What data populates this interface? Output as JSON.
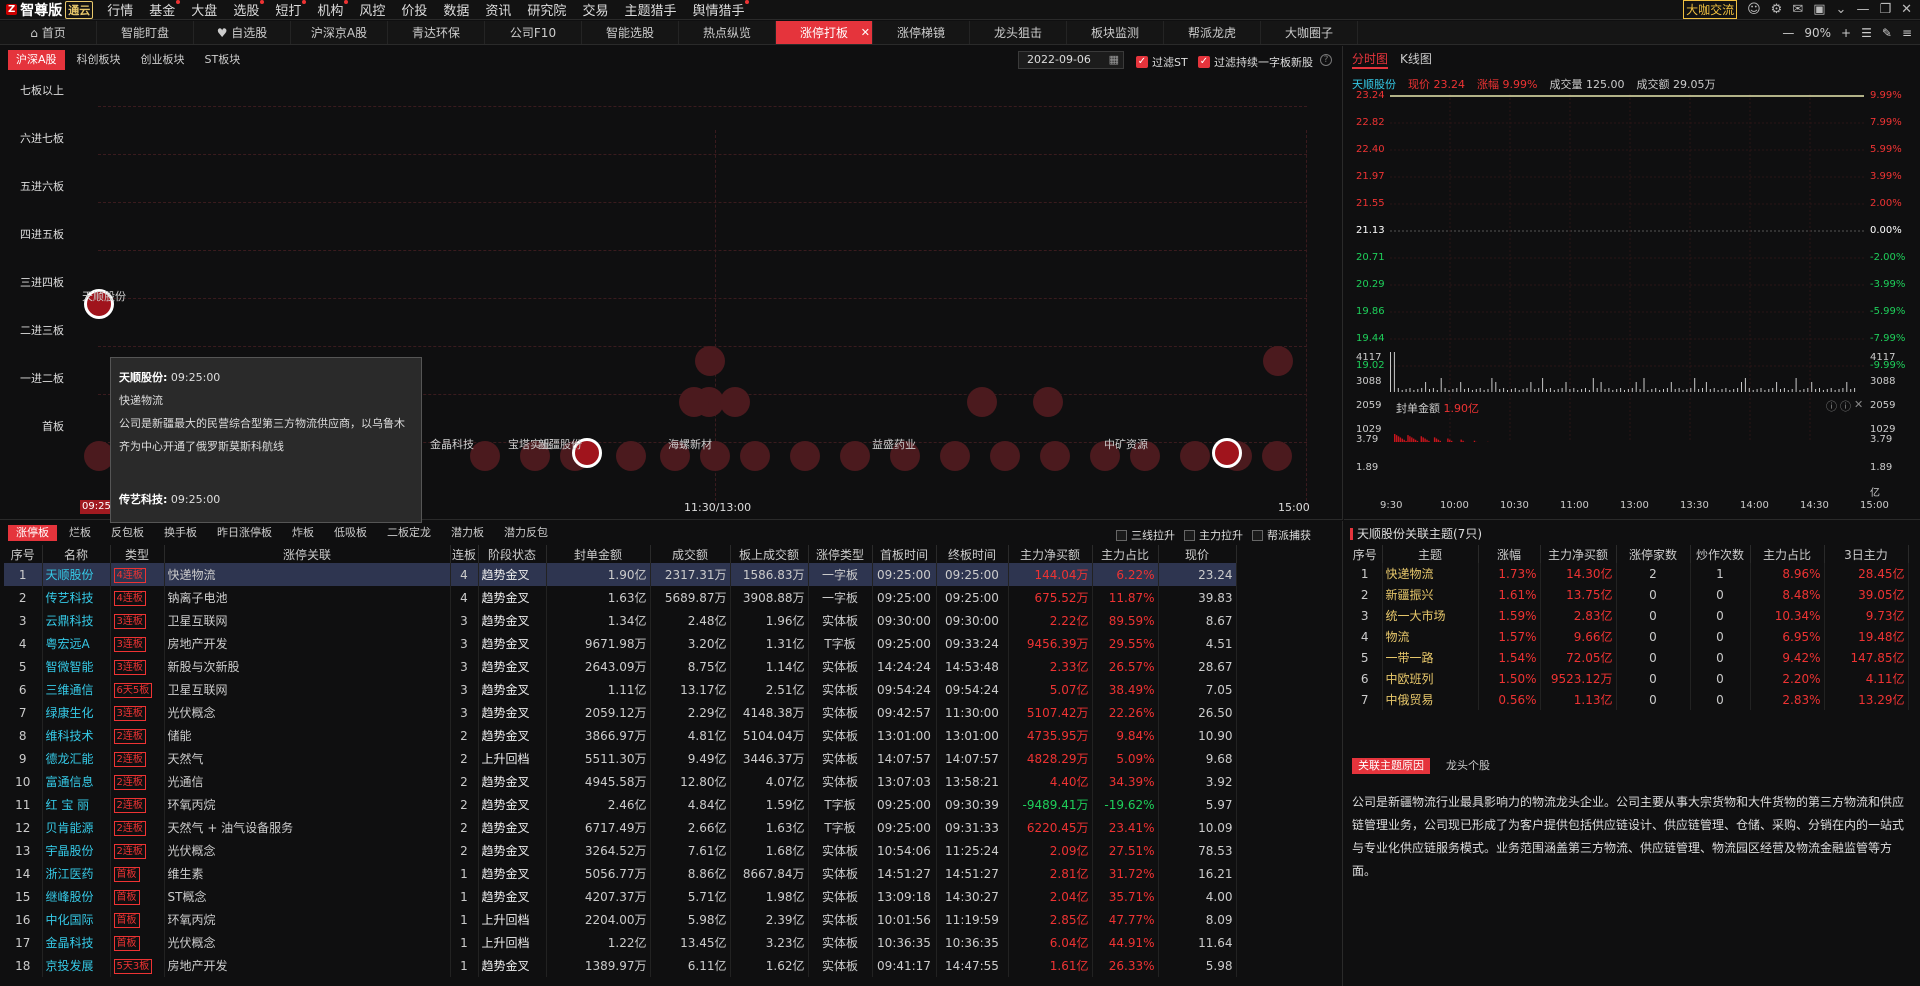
{
  "app": {
    "name": "智尊版",
    "version": "通云"
  },
  "menu": [
    {
      "label": "行情",
      "dot": false
    },
    {
      "label": "基金",
      "dot": true
    },
    {
      "label": "大盘",
      "dot": false
    },
    {
      "label": "选股",
      "dot": true
    },
    {
      "label": "短打",
      "dot": true
    },
    {
      "label": "机构",
      "dot": true
    },
    {
      "label": "风控",
      "dot": false
    },
    {
      "label": "价投",
      "dot": false
    },
    {
      "label": "数据",
      "dot": false
    },
    {
      "label": "资讯",
      "dot": false
    },
    {
      "label": "研究院",
      "dot": false
    },
    {
      "label": "交易",
      "dot": false
    },
    {
      "label": "主题猎手",
      "dot": false
    },
    {
      "label": "舆情猎手",
      "dot": true
    }
  ],
  "top_right": {
    "link": "大咖交流"
  },
  "tabs": [
    {
      "label": "首页",
      "icon": "home-icon"
    },
    {
      "label": "智能盯盘"
    },
    {
      "label": "自选股",
      "icon": "heart-icon"
    },
    {
      "label": "沪深京A股"
    },
    {
      "label": "青达环保"
    },
    {
      "label": "公司F10"
    },
    {
      "label": "智能选股"
    },
    {
      "label": "热点纵览"
    },
    {
      "label": "涨停打板",
      "active": true
    },
    {
      "label": "涨停梯镜"
    },
    {
      "label": "龙头狙击"
    },
    {
      "label": "板块监测"
    },
    {
      "label": "帮派龙虎"
    },
    {
      "label": "大咖圈子"
    }
  ],
  "zoom": "90%",
  "ladder": {
    "subtabs": [
      "沪深A股",
      "科创板块",
      "创业板块",
      "ST板块"
    ],
    "date": "2022-09-06",
    "filter_st": "过滤ST",
    "filter_new": "过滤持续一字板新股",
    "levels": [
      "七板以上",
      "六进七板",
      "五进六板",
      "四进五板",
      "三进四板",
      "二进三板",
      "一进二板",
      "首板"
    ],
    "time_start": "09:25:24",
    "time_mid": "11:30/13:00",
    "time_end": "15:00",
    "bubble_labels": [
      {
        "text": "天顺股份"
      },
      {
        "text": "金晶科技"
      },
      {
        "text": "宝塔实业"
      },
      {
        "text": "新疆股份"
      },
      {
        "text": "海螺新材"
      },
      {
        "text": "益盛药业"
      },
      {
        "text": "中矿资源"
      }
    ],
    "tooltip": {
      "name": "天顺股份:",
      "time": "09:25:00",
      "theme": "快递物流",
      "desc": "公司是新疆最大的民营综合型第三方物流供应商，以乌鲁木齐为中心开通了俄罗斯莫斯科航线",
      "next": "传艺科技:",
      "next_time": "09:25:00"
    }
  },
  "intraday": {
    "tabs": [
      "分时图",
      "K线图"
    ],
    "stock": "天顺股份",
    "price_label": "现价",
    "price": "23.24",
    "change_label": "涨幅",
    "change": "9.99%",
    "vol_label": "成交量",
    "vol": "125.00",
    "amt_label": "成交额",
    "amt": "29.05万",
    "y_left": [
      "23.24",
      "22.82",
      "22.40",
      "21.97",
      "21.55",
      "21.13",
      "20.71",
      "20.29",
      "19.86",
      "19.44",
      "19.02"
    ],
    "y_right": [
      "9.99%",
      "7.99%",
      "5.99%",
      "3.99%",
      "2.00%",
      "0.00%",
      "-2.00%",
      "-3.99%",
      "-5.99%",
      "-7.99%",
      "-9.99%"
    ],
    "vol_axis": [
      "4117",
      "3088",
      "2059",
      "1029"
    ],
    "seal_label": "封单金额",
    "seal_value": "1.90亿",
    "seal_axis": [
      "3.79",
      "1.89"
    ],
    "seal_unit": "亿",
    "x_labels": [
      "9:30",
      "10:00",
      "10:30",
      "11:00",
      "13:00",
      "13:30",
      "14:00",
      "14:30",
      "15:00"
    ]
  },
  "limitup": {
    "tabs": [
      "涨停板",
      "烂板",
      "反包板",
      "换手板",
      "昨日涨停板",
      "炸板",
      "低吸板",
      "二板定龙",
      "潜力板",
      "潜力反包"
    ],
    "options": [
      "三线拉升",
      "主力拉升",
      "帮派捕获"
    ],
    "headers": [
      "序号",
      "名称",
      "类型",
      "涨停关联",
      "连板",
      "阶段状态",
      "封单金额",
      "成交额",
      "板上成交额",
      "涨停类型",
      "首板时间",
      "终板时间",
      "主力净买额",
      "主力占比",
      "现价"
    ],
    "rows": [
      [
        "1",
        "天顺股份",
        "4连板",
        "快递物流",
        "4",
        "趋势金叉",
        "1.90亿",
        "2317.31万",
        "1586.83万",
        "一字板",
        "09:25:00",
        "09:25:00",
        "144.04万",
        "6.22%",
        "23.24"
      ],
      [
        "2",
        "传艺科技",
        "4连板",
        "钠离子电池",
        "4",
        "趋势金叉",
        "1.63亿",
        "5689.87万",
        "3908.88万",
        "一字板",
        "09:25:00",
        "09:25:00",
        "675.52万",
        "11.87%",
        "39.83"
      ],
      [
        "3",
        "云鼎科技",
        "3连板",
        "卫星互联网",
        "3",
        "趋势金叉",
        "1.34亿",
        "2.48亿",
        "1.96亿",
        "实体板",
        "09:30:00",
        "09:30:00",
        "2.22亿",
        "89.59%",
        "8.67"
      ],
      [
        "4",
        "粤宏远A",
        "3连板",
        "房地产开发",
        "3",
        "趋势金叉",
        "9671.98万",
        "3.20亿",
        "1.31亿",
        "T字板",
        "09:25:00",
        "09:33:24",
        "9456.39万",
        "29.55%",
        "4.51"
      ],
      [
        "5",
        "智微智能",
        "3连板",
        "新股与次新股",
        "3",
        "趋势金叉",
        "2643.09万",
        "8.75亿",
        "1.14亿",
        "实体板",
        "14:24:24",
        "14:53:48",
        "2.33亿",
        "26.57%",
        "28.67"
      ],
      [
        "6",
        "三维通信",
        "6天5板",
        "卫星互联网",
        "3",
        "趋势金叉",
        "1.11亿",
        "13.17亿",
        "2.51亿",
        "实体板",
        "09:54:24",
        "09:54:24",
        "5.07亿",
        "38.49%",
        "7.05"
      ],
      [
        "7",
        "绿康生化",
        "3连板",
        "光伏概念",
        "3",
        "趋势金叉",
        "2059.12万",
        "2.29亿",
        "4148.38万",
        "实体板",
        "09:42:57",
        "11:30:00",
        "5107.42万",
        "22.26%",
        "26.50"
      ],
      [
        "8",
        "维科技术",
        "2连板",
        "储能",
        "2",
        "趋势金叉",
        "3866.97万",
        "4.81亿",
        "5104.04万",
        "实体板",
        "13:01:00",
        "13:01:00",
        "4735.95万",
        "9.84%",
        "10.90"
      ],
      [
        "9",
        "德龙汇能",
        "2连板",
        "天然气",
        "2",
        "上升回档",
        "5511.30万",
        "9.49亿",
        "3446.37万",
        "实体板",
        "14:07:57",
        "14:07:57",
        "4828.29万",
        "5.09%",
        "9.68"
      ],
      [
        "10",
        "富通信息",
        "2连板",
        "光通信",
        "2",
        "趋势金叉",
        "4945.58万",
        "12.80亿",
        "4.07亿",
        "实体板",
        "13:07:03",
        "13:58:21",
        "4.40亿",
        "34.39%",
        "3.92"
      ],
      [
        "11",
        "红 宝 丽",
        "2连板",
        "环氧丙烷",
        "2",
        "趋势金叉",
        "2.46亿",
        "4.84亿",
        "1.59亿",
        "T字板",
        "09:25:00",
        "09:30:39",
        "-9489.41万",
        "-19.62%",
        "5.97"
      ],
      [
        "12",
        "贝肯能源",
        "2连板",
        "天然气 + 油气设备服务",
        "2",
        "趋势金叉",
        "6717.49万",
        "2.66亿",
        "1.63亿",
        "T字板",
        "09:25:00",
        "09:31:33",
        "6220.45万",
        "23.41%",
        "10.09"
      ],
      [
        "13",
        "宇晶股份",
        "2连板",
        "光伏概念",
        "2",
        "趋势金叉",
        "3264.52万",
        "7.61亿",
        "1.68亿",
        "实体板",
        "10:54:06",
        "11:25:24",
        "2.09亿",
        "27.51%",
        "78.53"
      ],
      [
        "14",
        "浙江医药",
        "首板",
        "维生素",
        "1",
        "趋势金叉",
        "5056.77万",
        "8.86亿",
        "8667.84万",
        "实体板",
        "14:51:27",
        "14:51:27",
        "2.81亿",
        "31.72%",
        "16.21"
      ],
      [
        "15",
        "继峰股份",
        "首板",
        "ST概念",
        "1",
        "趋势金叉",
        "4207.37万",
        "5.71亿",
        "1.98亿",
        "实体板",
        "13:09:18",
        "14:30:27",
        "2.04亿",
        "35.71%",
        "4.00"
      ],
      [
        "16",
        "中化国际",
        "首板",
        "环氧丙烷",
        "1",
        "上升回档",
        "2204.00万",
        "5.98亿",
        "2.39亿",
        "实体板",
        "10:01:56",
        "11:19:59",
        "2.85亿",
        "47.77%",
        "8.09"
      ],
      [
        "17",
        "金晶科技",
        "首板",
        "光伏概念",
        "1",
        "上升回档",
        "1.22亿",
        "13.45亿",
        "3.23亿",
        "实体板",
        "10:36:35",
        "10:36:35",
        "6.04亿",
        "44.91%",
        "11.64"
      ],
      [
        "18",
        "京投发展",
        "5天3板",
        "房地产开发",
        "1",
        "趋势金叉",
        "1389.97万",
        "6.11亿",
        "1.62亿",
        "实体板",
        "09:41:17",
        "14:47:55",
        "1.61亿",
        "26.33%",
        "5.98"
      ]
    ]
  },
  "themes": {
    "title": "天顺股份关联主题(7只)",
    "headers": [
      "序号",
      "主题",
      "涨幅",
      "主力净买额",
      "涨停家数",
      "炒作次数",
      "主力占比",
      "3日主力"
    ],
    "rows": [
      [
        "1",
        "快递物流",
        "1.73%",
        "14.30亿",
        "2",
        "1",
        "8.96%",
        "28.45亿"
      ],
      [
        "2",
        "新疆振兴",
        "1.61%",
        "13.75亿",
        "0",
        "0",
        "8.48%",
        "39.05亿"
      ],
      [
        "3",
        "统一大市场",
        "1.59%",
        "2.83亿",
        "0",
        "0",
        "10.34%",
        "9.73亿"
      ],
      [
        "4",
        "物流",
        "1.57%",
        "9.66亿",
        "0",
        "0",
        "6.95%",
        "19.48亿"
      ],
      [
        "5",
        "一带一路",
        "1.54%",
        "72.05亿",
        "0",
        "0",
        "9.42%",
        "147.85亿"
      ],
      [
        "6",
        "中欧班列",
        "1.50%",
        "9523.12万",
        "0",
        "0",
        "2.20%",
        "4.11亿"
      ],
      [
        "7",
        "中俄贸易",
        "0.56%",
        "1.13亿",
        "0",
        "0",
        "2.83%",
        "13.29亿"
      ]
    ],
    "desc_tabs": [
      "关联主题原因",
      "龙头个股"
    ],
    "desc": "公司是新疆物流行业最具影响力的物流龙头企业。公司主要从事大宗货物和大件货物的第三方物流和供应链管理业务，公司现已形成了为客户提供包括供应链设计、供应链管理、仓储、采购、分销在内的一站式与专业化供应链服务模式。业务范围涵盖第三方物流、供应链管理、物流园区经营及物流金融监管等方面。"
  },
  "colors": {
    "accent": "#e5343c",
    "up": "#ee3333",
    "down": "#1ecf5a",
    "name": "#35c9e6",
    "selected": "#2e3550"
  }
}
